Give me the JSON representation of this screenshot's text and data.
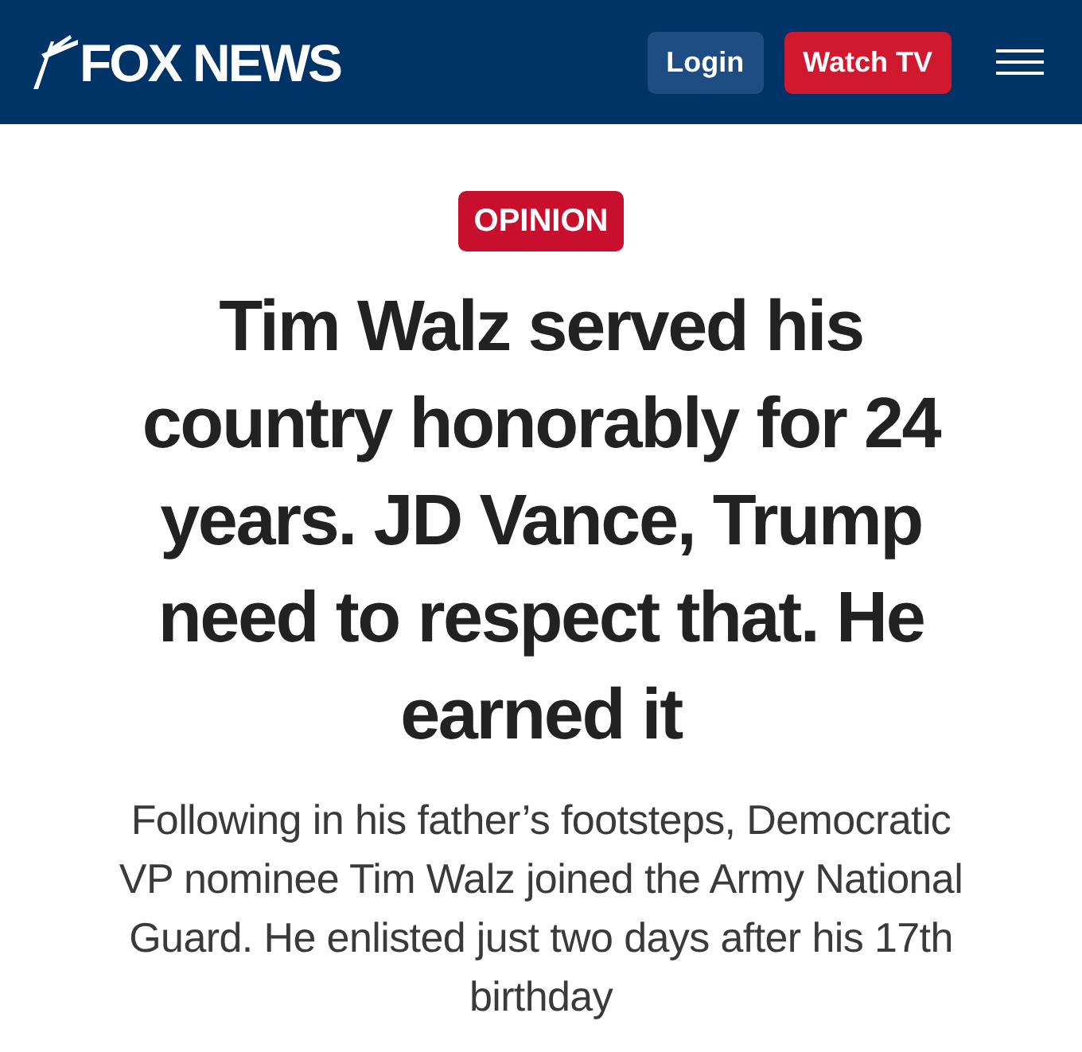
{
  "header": {
    "logo": {
      "text": "FOX NEWS"
    },
    "buttons": [
      {
        "label": "Login",
        "kind": "secondary"
      },
      {
        "label": "Watch TV",
        "kind": "primary"
      }
    ]
  },
  "article": {
    "section_badge": "OPINION",
    "headline": "Tim Walz served his country honorably for 24 years. JD Vance, Trump need to respect that. He earned it",
    "deck": "Following in his father’s footsteps, Democratic VP nominee Tim Walz joined the Army National Guard. He enlisted just two days after his 17th birthday"
  }
}
